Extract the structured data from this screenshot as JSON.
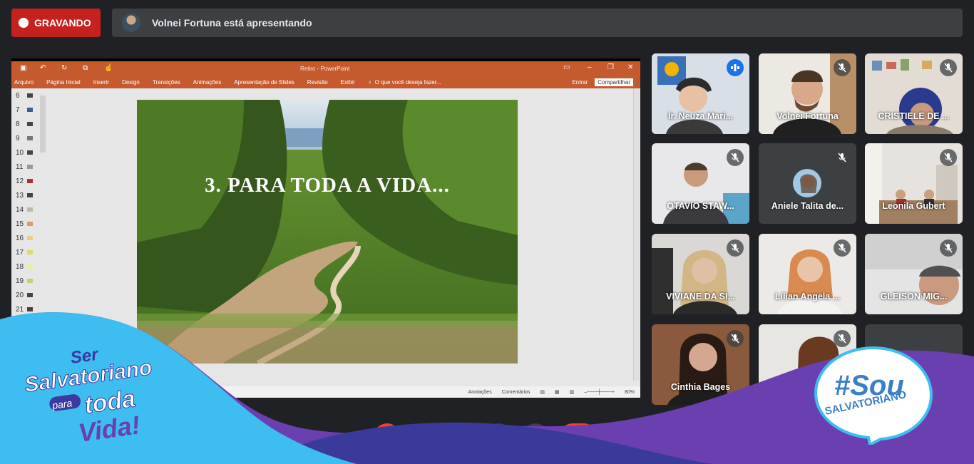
{
  "recording": {
    "label": "GRAVANDO"
  },
  "presenter": {
    "banner": "Volnei Fortuna está apresentando"
  },
  "powerpoint": {
    "window_title": "Retiro - PowerPoint",
    "ribbon_tabs": [
      "Arquivo",
      "Página Inicial",
      "Inserir",
      "Design",
      "Transições",
      "Animações",
      "Apresentação de Slides",
      "Revisão",
      "Exibir"
    ],
    "tell_me": "O que você deseja fazer...",
    "sign_in": "Entrar",
    "share": "Compartilhar",
    "thumbnail_numbers": [
      "6",
      "7",
      "8",
      "9",
      "10",
      "11",
      "12",
      "13",
      "14",
      "15",
      "16",
      "17",
      "18",
      "19",
      "20",
      "21"
    ],
    "slide_title": "3. PARA TODA A VIDA...",
    "status": {
      "notes": "Anotações",
      "comments": "Comentários",
      "zoom": "80%"
    }
  },
  "participants": [
    {
      "name": "Ir. Neuza Mari...",
      "mic": "speaking",
      "active": true
    },
    {
      "name": "Volnei Fortuna",
      "mic": "off",
      "active": false
    },
    {
      "name": "CRISTIELE DE ...",
      "mic": "off",
      "active": false
    },
    {
      "name": "OTAVIO STAW...",
      "mic": "off",
      "active": false
    },
    {
      "name": "Aniele Talita de...",
      "mic": "off",
      "active": false
    },
    {
      "name": "Leonila Gubert",
      "mic": "off",
      "active": false
    },
    {
      "name": "VIVIANE DA SI...",
      "mic": "off",
      "active": false
    },
    {
      "name": "Lílian Angela ...",
      "mic": "off",
      "active": false
    },
    {
      "name": "GLEISON MIG...",
      "mic": "off",
      "active": false
    },
    {
      "name": "Cinthia Bages",
      "mic": "off",
      "active": false
    },
    {
      "name": "",
      "mic": "off",
      "active": false
    },
    {
      "name": "",
      "mic": "none",
      "active": false
    }
  ],
  "branding": {
    "left_logo_text": "Ser Salvatoriano para toda Vida!",
    "right_logo_text": "#Sou SALVATORIANO"
  },
  "colors": {
    "recording_red": "#c5221f",
    "meet_dark": "#202124",
    "tile_bg": "#3c4043",
    "ppt_orange": "#c55a2f",
    "overlay_cyan": "#3dbdf0",
    "overlay_purple": "#6a3fb0"
  }
}
